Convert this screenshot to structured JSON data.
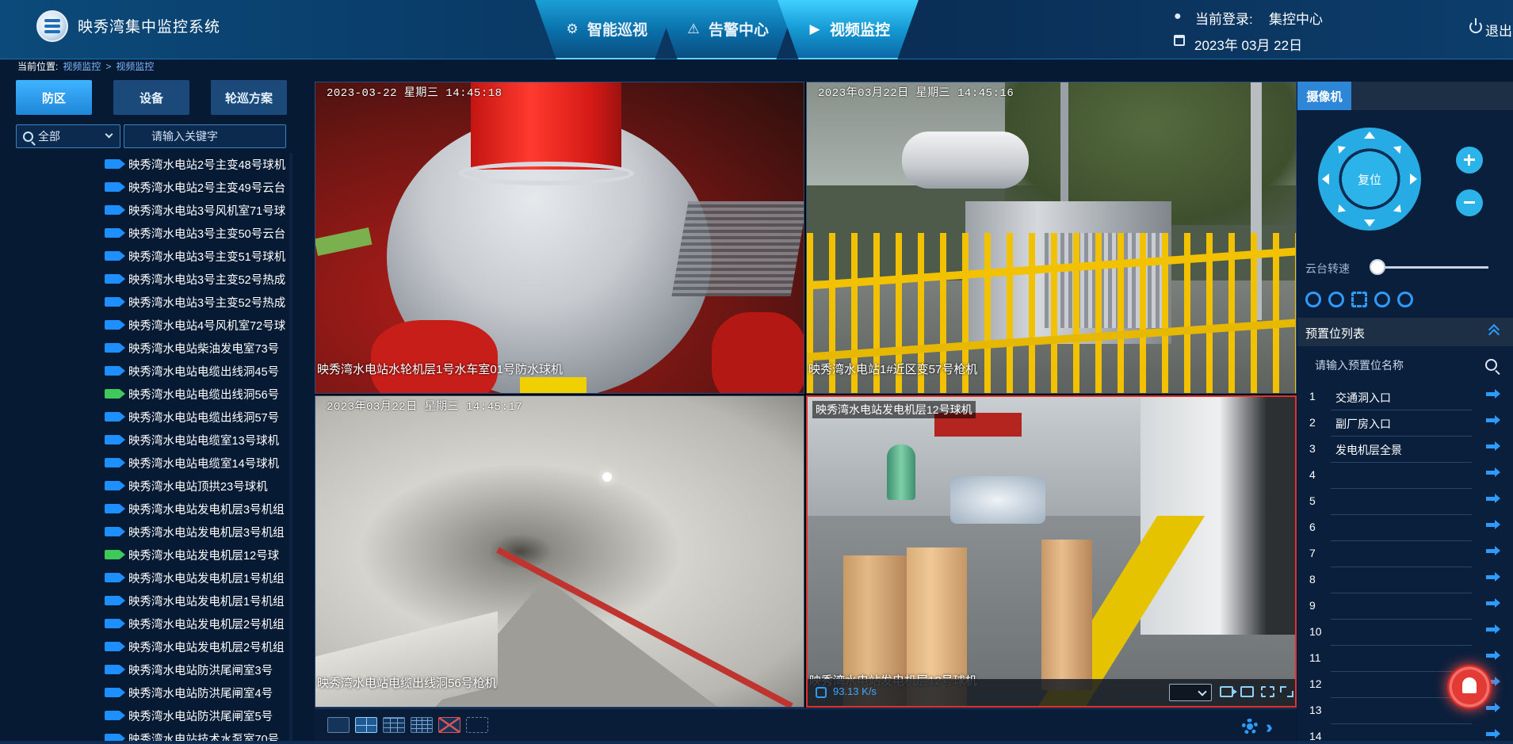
{
  "app": {
    "title": "映秀湾集中监控系统"
  },
  "nav": {
    "tabs": [
      {
        "label": "智能巡视",
        "icon": "robot-icon"
      },
      {
        "label": "告警中心",
        "icon": "warning-icon"
      },
      {
        "label": "视频监控",
        "icon": "video-icon",
        "active": true
      }
    ]
  },
  "user": {
    "login_label": "当前登录:",
    "login_user": "集控中心",
    "date": "2023年 03月 22日",
    "logout": "退出"
  },
  "breadcrumb": {
    "label": "当前位置:",
    "items": [
      "视频监控",
      "视频监控"
    ],
    "separator": ">"
  },
  "left": {
    "tabs": [
      {
        "label": "防区",
        "active": true
      },
      {
        "label": "设备"
      },
      {
        "label": "轮巡方案"
      }
    ],
    "filter": "全部",
    "keyword_placeholder": "请输入关键字",
    "cameras": [
      {
        "label": "映秀湾水电站2号主变48号球机",
        "status": "blue"
      },
      {
        "label": "映秀湾水电站2号主变49号云台",
        "status": "blue"
      },
      {
        "label": "映秀湾水电站3号风机室71号球",
        "status": "blue"
      },
      {
        "label": "映秀湾水电站3号主变50号云台",
        "status": "blue"
      },
      {
        "label": "映秀湾水电站3号主变51号球机",
        "status": "blue"
      },
      {
        "label": "映秀湾水电站3号主变52号热成",
        "status": "blue"
      },
      {
        "label": "映秀湾水电站3号主变52号热成",
        "status": "blue"
      },
      {
        "label": "映秀湾水电站4号风机室72号球",
        "status": "blue"
      },
      {
        "label": "映秀湾水电站柴油发电室73号",
        "status": "blue"
      },
      {
        "label": "映秀湾水电站电缆出线洞45号",
        "status": "blue"
      },
      {
        "label": "映秀湾水电站电缆出线洞56号",
        "status": "green"
      },
      {
        "label": "映秀湾水电站电缆出线洞57号",
        "status": "blue"
      },
      {
        "label": "映秀湾水电站电缆室13号球机",
        "status": "blue"
      },
      {
        "label": "映秀湾水电站电缆室14号球机",
        "status": "blue"
      },
      {
        "label": "映秀湾水电站顶拱23号球机",
        "status": "blue"
      },
      {
        "label": "映秀湾水电站发电机层3号机组",
        "status": "blue"
      },
      {
        "label": "映秀湾水电站发电机层3号机组",
        "status": "blue"
      },
      {
        "label": "映秀湾水电站发电机层12号球",
        "status": "green"
      },
      {
        "label": "映秀湾水电站发电机层1号机组",
        "status": "blue"
      },
      {
        "label": "映秀湾水电站发电机层1号机组",
        "status": "blue"
      },
      {
        "label": "映秀湾水电站发电机层2号机组",
        "status": "blue"
      },
      {
        "label": "映秀湾水电站发电机层2号机组",
        "status": "blue"
      },
      {
        "label": "映秀湾水电站防洪尾闸室3号",
        "status": "blue"
      },
      {
        "label": "映秀湾水电站防洪尾闸室4号",
        "status": "blue"
      },
      {
        "label": "映秀湾水电站防洪尾闸室5号",
        "status": "blue"
      },
      {
        "label": "映秀湾水电站技术水泵室70号",
        "status": "blue"
      }
    ]
  },
  "feeds": [
    {
      "timestamp": "2023-03-22 星期三 14:45:18",
      "caption": "映秀湾水电站水轮机层1号水车室01号防水球机"
    },
    {
      "timestamp": "2023年03月22日 星期三 14:45:16",
      "caption": "映秀湾水电站1#近区变57号枪机"
    },
    {
      "timestamp": "2023年03月22日 星期三 14:45:17",
      "caption": "映秀湾水电站电缆出线洞56号枪机"
    },
    {
      "timestamp": "",
      "title": "映秀湾水电站发电机层12号球机",
      "caption": "映秀湾水电站发电机层12号球机",
      "speed": "93.13 K/s",
      "selected": true
    }
  ],
  "right": {
    "camera_tab": "摄像机",
    "ptz_reset": "复位",
    "speed_label": "云台转速",
    "speed_value": 0,
    "preset_title": "预置位列表",
    "preset_search_placeholder": "请输入预置位名称",
    "presets": [
      {
        "num": "1",
        "name": "交通洞入口"
      },
      {
        "num": "2",
        "name": "副厂房入口"
      },
      {
        "num": "3",
        "name": "发电机层全景"
      },
      {
        "num": "4",
        "name": ""
      },
      {
        "num": "5",
        "name": ""
      },
      {
        "num": "6",
        "name": ""
      },
      {
        "num": "7",
        "name": ""
      },
      {
        "num": "8",
        "name": ""
      },
      {
        "num": "9",
        "name": ""
      },
      {
        "num": "10",
        "name": ""
      },
      {
        "num": "11",
        "name": ""
      },
      {
        "num": "12",
        "name": ""
      },
      {
        "num": "13",
        "name": ""
      },
      {
        "num": "14",
        "name": ""
      }
    ]
  },
  "colors": {
    "accent": "#2e9bff",
    "online": "#3ec95a",
    "alarm": "#e33a35",
    "header": "#0a3a66"
  }
}
